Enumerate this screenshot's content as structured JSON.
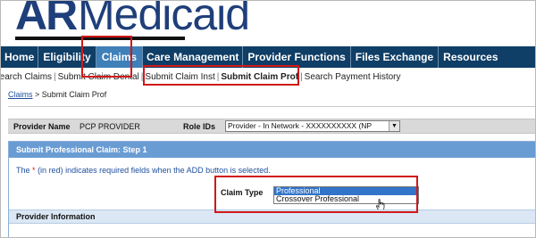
{
  "logo": {
    "ar": "AR",
    "medicaid": "Medicaid"
  },
  "nav": {
    "items": [
      {
        "label": "Home",
        "active": false
      },
      {
        "label": "Eligibility",
        "active": false
      },
      {
        "label": "Claims",
        "active": true
      },
      {
        "label": "Care Management",
        "active": false
      },
      {
        "label": "Provider Functions",
        "active": false
      },
      {
        "label": "Files Exchange",
        "active": false
      },
      {
        "label": "Resources",
        "active": false
      }
    ]
  },
  "subnav": {
    "items": [
      "Search Claims",
      "Submit Claim Dental",
      "Submit Claim Inst",
      "Submit Claim Prof",
      "Search Payment History"
    ],
    "separator": "|",
    "current": "Submit Claim Prof"
  },
  "breadcrumb": {
    "link": "Claims",
    "separator": " > ",
    "current": "Submit Claim Prof"
  },
  "provider": {
    "name_label": "Provider Name",
    "name_value": "PCP PROVIDER",
    "role_label": "Role IDs",
    "role_value": "Provider - In Network -     XXXXXXXXXX (NP"
  },
  "panel": {
    "title": "Submit Professional Claim: Step 1",
    "note_prefix": "The",
    "note_star": "*",
    "note_suffix": "(in red) indicates required fields when the ADD button is selected.",
    "claim_type_label": "Claim Type",
    "claim_type_options": [
      "Professional",
      "Crossover Professional"
    ],
    "claim_type_selected": "Professional",
    "section_title": "Provider Information"
  },
  "colors": {
    "nav_bg": "#0f3e66",
    "nav_active": "#3f80b9",
    "panel_head": "#6a9cd4",
    "highlight_box": "#d01818",
    "logo": "#1f3f7a"
  }
}
